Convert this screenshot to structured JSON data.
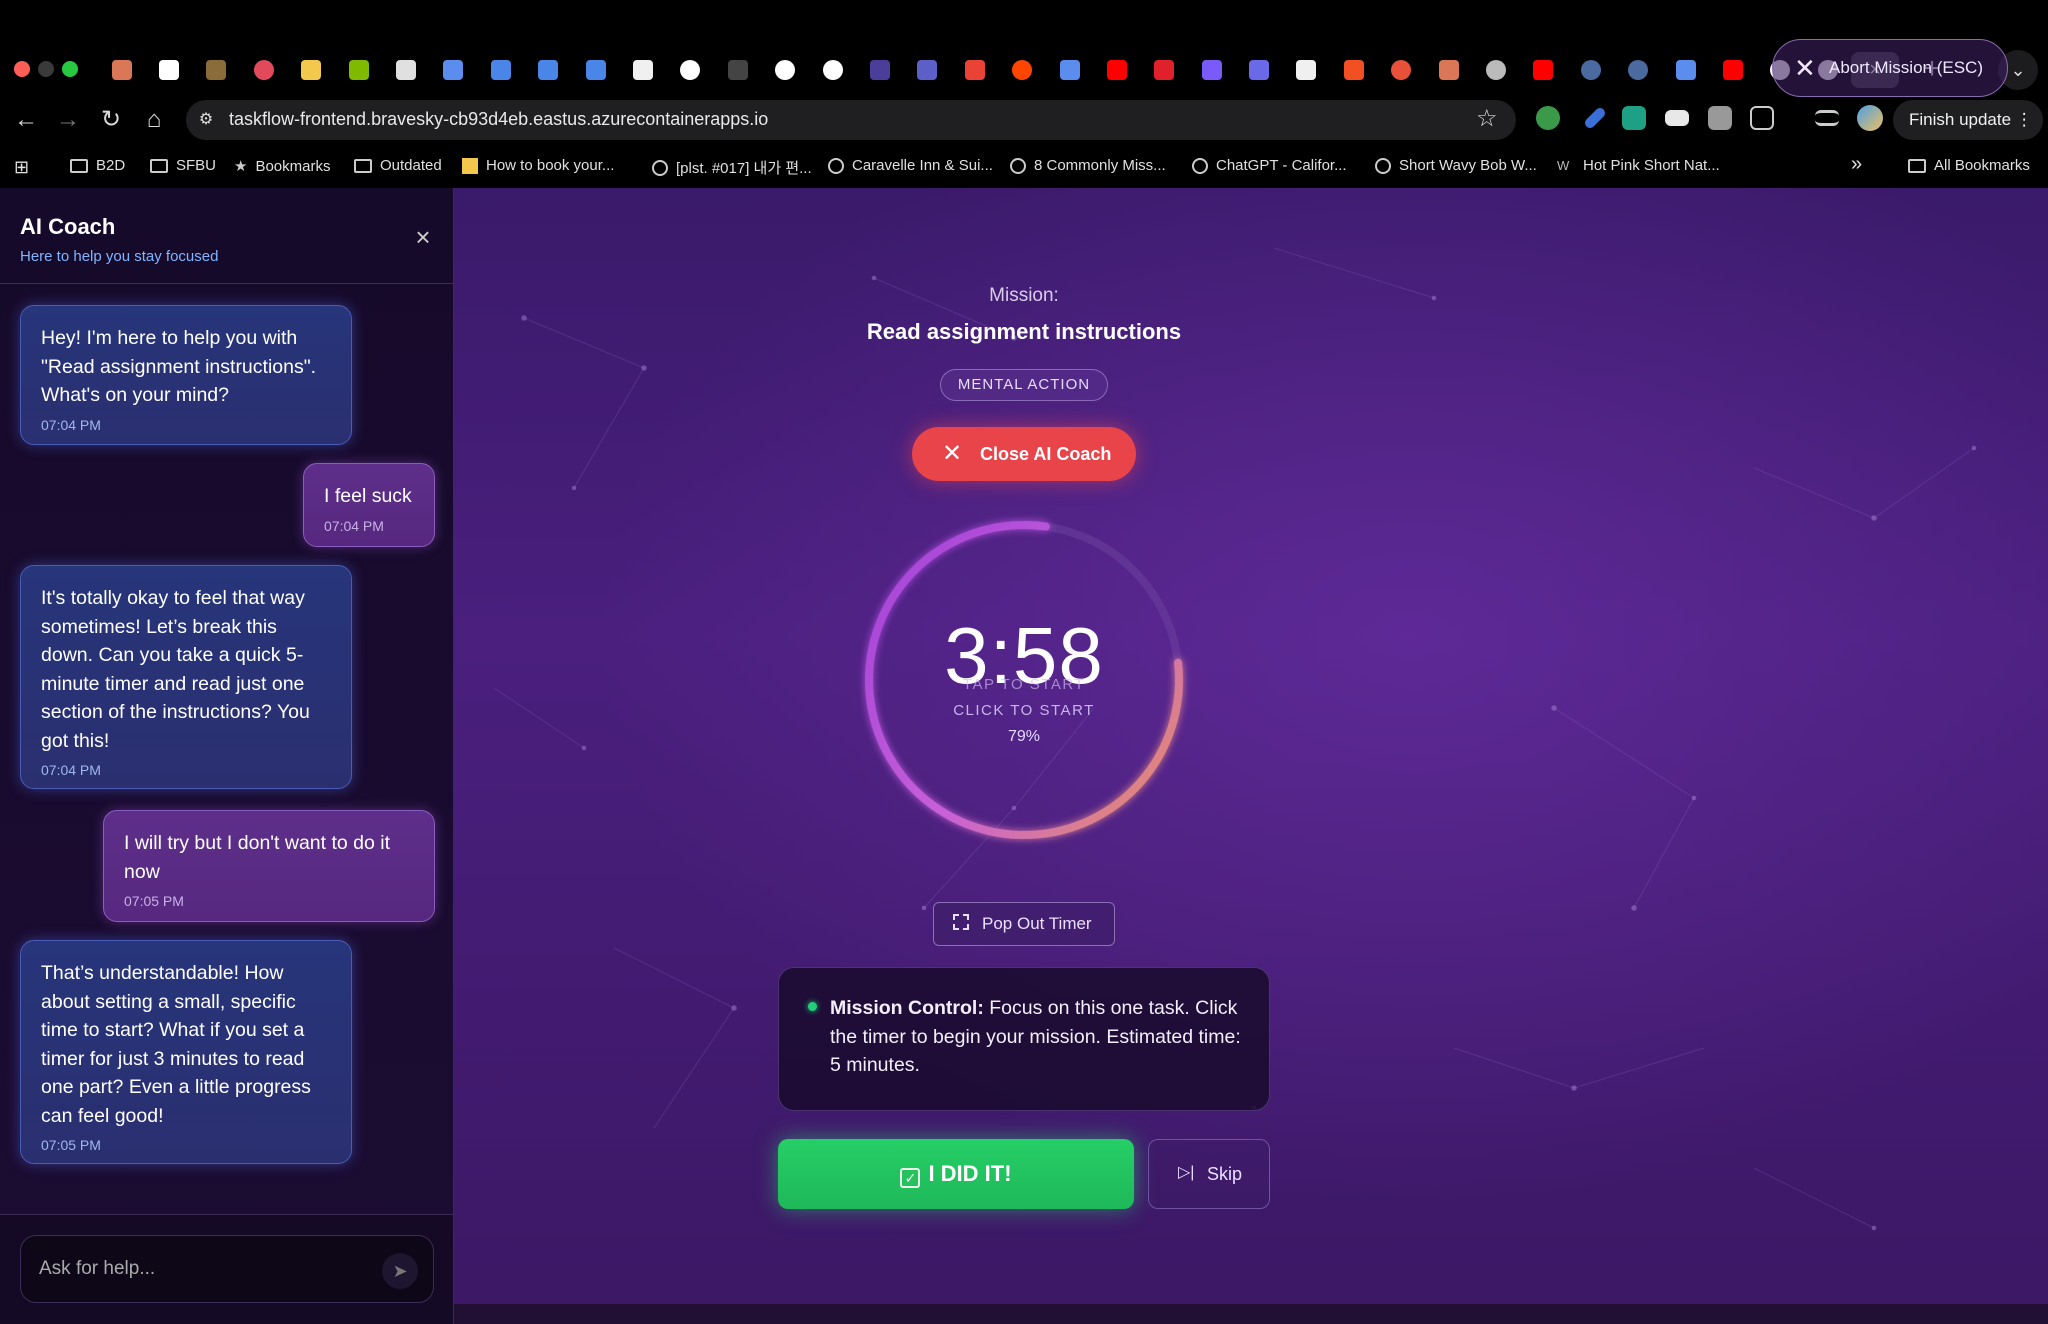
{
  "browser": {
    "url": "taskflow-frontend.bravesky-cb93d4eb.eastus.azurecontainerapps.io",
    "finish_update_label": "Finish update",
    "tabs": [
      {
        "icon": "claude-icon",
        "color": "#d97757"
      },
      {
        "icon": "app-icon",
        "color": "#ffffff"
      },
      {
        "icon": "notebook-icon",
        "color": "#8a6b3a"
      },
      {
        "icon": "firefox-icon",
        "color": "#e04a5a"
      },
      {
        "icon": "bee-icon",
        "color": "#f2c94c"
      },
      {
        "icon": "microsoft-icon",
        "color": "#7fba00"
      },
      {
        "icon": "zotero-icon",
        "color": "#e0e0e0"
      },
      {
        "icon": "gemini-icon",
        "color": "#5b8def"
      },
      {
        "icon": "docs-icon",
        "color": "#4a86e8"
      },
      {
        "icon": "docs-icon",
        "color": "#4a86e8"
      },
      {
        "icon": "docs-icon",
        "color": "#4a86e8"
      },
      {
        "icon": "github-icon",
        "color": "#f0f0f0"
      },
      {
        "icon": "google-icon",
        "color": "#ffffff"
      },
      {
        "icon": "dash-icon",
        "color": "#444444"
      },
      {
        "icon": "google-icon",
        "color": "#ffffff"
      },
      {
        "icon": "google-icon",
        "color": "#ffffff"
      },
      {
        "icon": "cloud-icon",
        "color": "#4a3e9a"
      },
      {
        "icon": "teams-icon",
        "color": "#5b5fc7"
      },
      {
        "icon": "gmail-icon",
        "color": "#ea4335"
      },
      {
        "icon": "reddit-icon",
        "color": "#ff4500"
      },
      {
        "icon": "gemini-icon",
        "color": "#5b8def"
      },
      {
        "icon": "youtube-icon",
        "color": "#ff0000"
      },
      {
        "icon": "fi-icon",
        "color": "#e0202a"
      },
      {
        "icon": "sparkle-icon",
        "color": "#7a5af8"
      },
      {
        "icon": "question-icon",
        "color": "#6a6ae8"
      },
      {
        "icon": "github-icon",
        "color": "#f0f0f0"
      },
      {
        "icon": "microsoft-icon",
        "color": "#f25022"
      },
      {
        "icon": "p-icon",
        "color": "#e8503a"
      },
      {
        "icon": "claude-icon",
        "color": "#d97757"
      },
      {
        "icon": "globe-icon",
        "color": "#bbbbbb"
      },
      {
        "icon": "youtube-icon",
        "color": "#ff0000"
      },
      {
        "icon": "chatgpt-icon",
        "color": "#4a6aa0"
      },
      {
        "icon": "chatgpt-icon",
        "color": "#4a6aa0"
      },
      {
        "icon": "gemini-icon",
        "color": "#5b8def"
      },
      {
        "icon": "youtube-icon",
        "color": "#ff0000"
      },
      {
        "icon": "google-icon",
        "color": "#ffffff"
      },
      {
        "icon": "google-icon",
        "color": "#ffffff"
      }
    ],
    "bookmarks": [
      {
        "label": "B2D",
        "icon": "folder-icon"
      },
      {
        "label": "SFBU",
        "icon": "folder-icon"
      },
      {
        "label": "Bookmarks",
        "icon": "star-icon"
      },
      {
        "label": "Outdated",
        "icon": "folder-icon"
      },
      {
        "label": "How to book your...",
        "icon": "s-icon"
      },
      {
        "label": "[plst. #017] 내가 편...",
        "icon": "globe-icon"
      },
      {
        "label": "Caravelle Inn & Sui...",
        "icon": "globe-icon"
      },
      {
        "label": "8 Commonly Miss...",
        "icon": "globe-icon"
      },
      {
        "label": "ChatGPT - Califor...",
        "icon": "globe-icon"
      },
      {
        "label": "Short Wavy Bob W...",
        "icon": "globe-icon"
      },
      {
        "label": "Hot Pink Short Nat...",
        "icon": "w-icon"
      }
    ],
    "more_bookmarks": "»",
    "all_bookmarks": "All Bookmarks"
  },
  "sidebar": {
    "title": "AI Coach",
    "subtitle": "Here to help you stay focused",
    "messages": [
      {
        "role": "coach",
        "text": "Hey! I'm here to help you with \"Read assignment instructions\". What's on your mind?",
        "time": "07:04 PM"
      },
      {
        "role": "user",
        "text": "I feel suck",
        "time": "07:04 PM"
      },
      {
        "role": "coach",
        "text": "It's totally okay to feel that way sometimes! Let’s break this down. Can you take a quick 5-minute timer and read just one section of the instructions? You got this!",
        "time": "07:04 PM"
      },
      {
        "role": "user",
        "text": "I will try but I don't want to do it now",
        "time": "07:05 PM"
      },
      {
        "role": "coach",
        "text": "That’s understandable! How about setting a small, specific time to start? What if you set a timer for just 3 minutes to read one part? Even a little progress can feel good!",
        "time": "07:05 PM"
      }
    ],
    "input_placeholder": "Ask for help..."
  },
  "mission": {
    "abort_label": "Abort Mission (ESC)",
    "label": "Mission:",
    "title": "Read assignment instructions",
    "tag": "MENTAL ACTION",
    "close_coach_label": "Close AI Coach",
    "timer": {
      "time": "3:58",
      "tap_hint": "TAP TO START",
      "click_hint": "CLICK TO START",
      "percent_label": "79%",
      "progress": 0.79,
      "colors": [
        "#b04be0",
        "#e08a50"
      ]
    },
    "popout_label": "Pop Out Timer",
    "control": {
      "heading": "Mission Control:",
      "text": " Focus on this one task. Click the timer to begin your mission. Estimated time: 5 minutes."
    },
    "did_it_label": "I DID IT!",
    "skip_label": "Skip"
  }
}
